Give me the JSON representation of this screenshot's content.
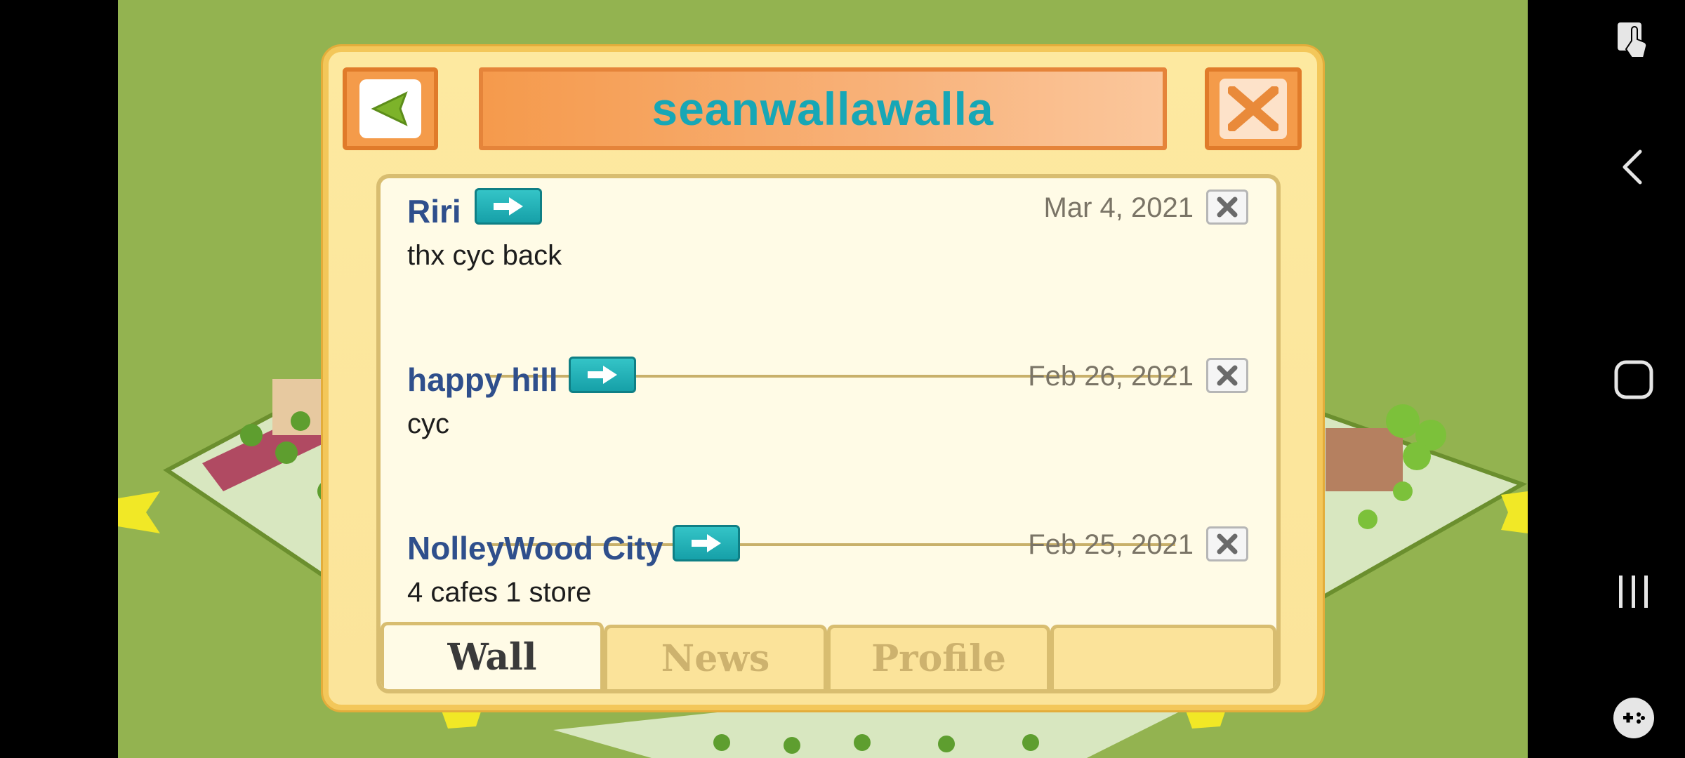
{
  "app": {
    "title": "seanwallawalla"
  },
  "dialog": {
    "back_icon": "back-triangle-icon",
    "close_icon": "close-x-icon"
  },
  "posts": [
    {
      "author": "Riri",
      "date": "Mar 4, 2021",
      "message": "thx cyc back"
    },
    {
      "author": "happy hill",
      "date": "Feb 26, 2021",
      "message": "cyc"
    },
    {
      "author": "NolleyWood City",
      "date": "Feb 25, 2021",
      "message": "4 cafes 1 store"
    }
  ],
  "tabs": [
    {
      "label": "Wall",
      "active": true
    },
    {
      "label": "News",
      "active": false
    },
    {
      "label": "Profile",
      "active": false
    },
    {
      "label": "",
      "active": false
    }
  ],
  "colors": {
    "title": "#17a7b6",
    "author": "#2f4f8c",
    "accent_orange": "#f49b4a",
    "panel": "#fffbe6"
  },
  "system_nav": {
    "icons": [
      "screen-touch-icon",
      "back-chevron-icon",
      "home-icon",
      "recent-apps-icon",
      "game-tools-icon"
    ]
  }
}
